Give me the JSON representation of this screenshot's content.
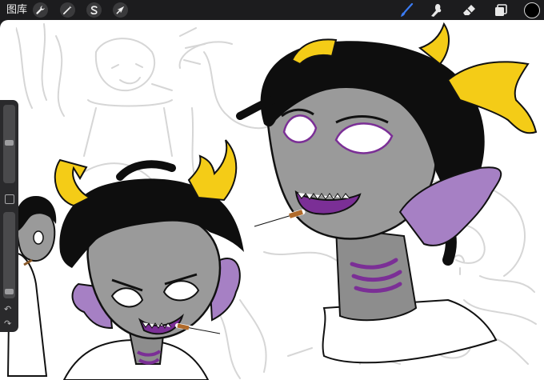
{
  "app": {
    "gallery_label": "图库",
    "active_color": "#000000"
  },
  "toolbar": {
    "left_tools": [
      {
        "name": "actions",
        "icon": "wrench-icon"
      },
      {
        "name": "adjustments",
        "icon": "magic-wand-icon"
      },
      {
        "name": "selection",
        "icon": "selection-s-icon"
      },
      {
        "name": "transform",
        "icon": "arrow-cursor-icon"
      }
    ],
    "right_tools": [
      {
        "name": "brush",
        "icon": "brush-icon",
        "active": true,
        "color": "#3b7cf4"
      },
      {
        "name": "smudge",
        "icon": "smudge-finger-icon"
      },
      {
        "name": "eraser",
        "icon": "eraser-icon"
      },
      {
        "name": "layers",
        "icon": "layers-icon"
      }
    ]
  },
  "sidebar": {
    "brush_size_level": 0.52,
    "opacity_level": 0.03,
    "undo_icon": "undo-arrow-icon",
    "redo_icon": "redo-arrow-icon",
    "modify_icon": "square-modify-icon"
  },
  "canvas": {
    "artwork_colors": {
      "skin": "#9a9a9a",
      "skin_shadow": "#7c7c7c",
      "hair": "#0e0e0e",
      "horns": "#f4cc17",
      "fins": "#a680c4",
      "mouth": "#7b2f96",
      "sketch_lines": "#d8d8d8"
    }
  }
}
